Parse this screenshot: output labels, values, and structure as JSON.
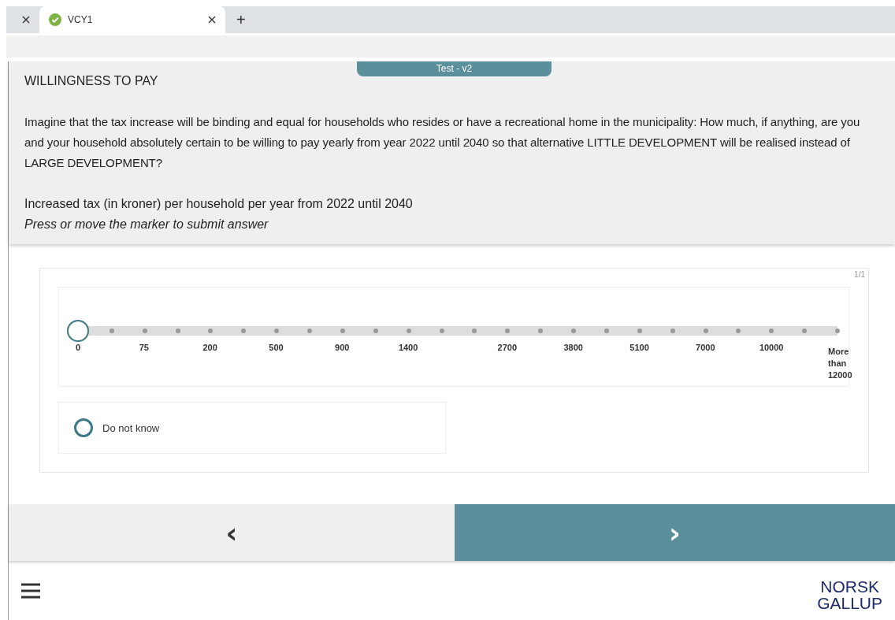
{
  "browser": {
    "tabs": [
      {
        "selected": false,
        "complete": false
      },
      {
        "title": "VCY1",
        "selected": true,
        "complete": true
      }
    ],
    "new_tab": "+"
  },
  "version_badge": "Test - v2",
  "header": {
    "title": "WILLINGNESS TO PAY",
    "question": "Imagine that the tax increase will be binding and equal for households who resides or have a recreational home in the municipality: How much, if anything, are you and your household absolutely certain to be willing to pay yearly from year 2022 until 2040 so that alternative LITTLE DEVELOPMENT will be realised instead of LARGE DEVELOPMENT?",
    "scale_label": "Increased tax (in kroner) per household per year from 2022 until 2040",
    "instruction": "Press or move the marker to submit answer"
  },
  "card": {
    "counter": "1/1",
    "slider": {
      "level": 0,
      "ticks": [
        {
          "kind": "labeled",
          "label": "0"
        },
        {
          "kind": "dot"
        },
        {
          "kind": "labeled",
          "label": "75"
        },
        {
          "kind": "dot"
        },
        {
          "kind": "labeled",
          "label": "200"
        },
        {
          "kind": "dot"
        },
        {
          "kind": "labeled",
          "label": "500"
        },
        {
          "kind": "dot"
        },
        {
          "kind": "labeled",
          "label": "900"
        },
        {
          "kind": "dot"
        },
        {
          "kind": "labeled",
          "label": "1400"
        },
        {
          "kind": "dot"
        },
        {
          "kind": "dot"
        },
        {
          "kind": "labeled",
          "label": "2700"
        },
        {
          "kind": "dot"
        },
        {
          "kind": "labeled",
          "label": "3800"
        },
        {
          "kind": "dot"
        },
        {
          "kind": "labeled",
          "label": "5100"
        },
        {
          "kind": "dot"
        },
        {
          "kind": "labeled",
          "label": "7000"
        },
        {
          "kind": "dot"
        },
        {
          "kind": "labeled",
          "label": "10000"
        },
        {
          "kind": "dot"
        },
        {
          "kind": "labeled",
          "label": "More than 12000"
        }
      ]
    },
    "options": [
      {
        "label": "Do not know",
        "selected": false
      }
    ]
  },
  "nav": {
    "back": "‹",
    "next": "›"
  },
  "logo": [
    "NORSK",
    "GALLUP"
  ]
}
